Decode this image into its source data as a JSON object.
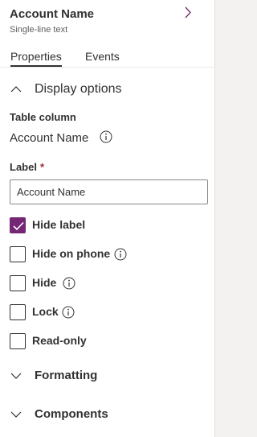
{
  "header": {
    "title": "Account Name",
    "subtitle": "Single-line text",
    "collapse_icon": "chevron-right-icon"
  },
  "tabs": [
    {
      "label": "Properties",
      "selected": true
    },
    {
      "label": "Events",
      "selected": false
    }
  ],
  "sections": {
    "display_options": {
      "label": "Display options",
      "expanded": true,
      "icon": "chevron-up-icon"
    },
    "formatting": {
      "label": "Formatting",
      "expanded": false,
      "icon": "chevron-down-icon"
    },
    "components": {
      "label": "Components",
      "expanded": false,
      "icon": "chevron-down-icon"
    }
  },
  "table_column": {
    "caption": "Table column",
    "value": "Account Name",
    "info_icon": "info-icon"
  },
  "label_field": {
    "caption": "Label",
    "required_marker": "*",
    "value": "Account Name"
  },
  "checkboxes": [
    {
      "label": "Hide label",
      "checked": true,
      "info": false
    },
    {
      "label": "Hide on phone",
      "checked": false,
      "info": true
    },
    {
      "label": "Hide",
      "checked": false,
      "info": true
    },
    {
      "label": "Lock",
      "checked": false,
      "info": true
    },
    {
      "label": "Read-only",
      "checked": false,
      "info": false
    }
  ],
  "colors": {
    "accent": "#742774",
    "text": "#323130",
    "secondary_text": "#605e5c",
    "required": "#a4262c"
  }
}
